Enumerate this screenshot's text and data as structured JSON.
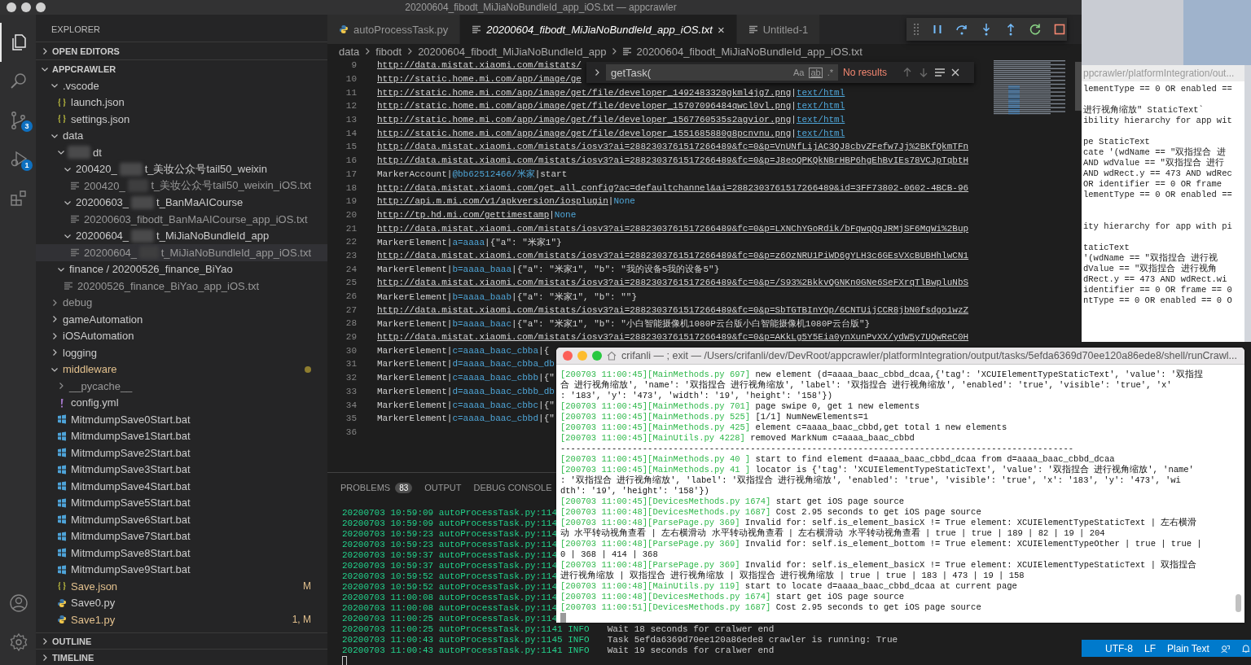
{
  "window": {
    "title": "20200604_fibodt_MiJiaNoBundleId_app_iOS.txt — appcrawler"
  },
  "activity_bar": {
    "items": [
      {
        "kind": "files",
        "selected": true
      },
      {
        "kind": "search",
        "selected": false
      },
      {
        "kind": "source-control",
        "selected": false,
        "badge": "3"
      },
      {
        "kind": "debug",
        "selected": false,
        "badge": "1"
      },
      {
        "kind": "extensions",
        "selected": false
      }
    ],
    "bottom": [
      {
        "kind": "account"
      },
      {
        "kind": "settings"
      }
    ]
  },
  "sidebar": {
    "title": "EXPLORER",
    "sections": [
      {
        "label": "OPEN EDITORS",
        "expanded": false
      },
      {
        "label": "APPCRAWLER",
        "expanded": true
      }
    ],
    "tree": [
      {
        "name": ".vscode",
        "kind": "folder",
        "expanded": true,
        "modified": false,
        "dimmed": false,
        "selected": false,
        "children": [
          {
            "name": "launch.json",
            "kind": "json",
            "modified": false,
            "dimmed": false,
            "selected": false
          },
          {
            "name": "settings.json",
            "kind": "json",
            "modified": false,
            "dimmed": false,
            "selected": false
          }
        ]
      },
      {
        "name": "data",
        "kind": "folder",
        "expanded": true,
        "modified": false,
        "dimmed": false,
        "selected": false,
        "children": [
          {
            "redacted": true,
            "tail": "dt",
            "kind": "folder",
            "expanded": true,
            "modified": false,
            "dimmed": false,
            "selected": false,
            "children": [
              {
                "name": "200420_",
                "redacted": true,
                "tail": "t_美妆公众号tail50_weixin",
                "kind": "folder",
                "expanded": true,
                "modified": false,
                "dimmed": false,
                "selected": false,
                "children": [
                  {
                    "name": "200420_",
                    "redacted": true,
                    "tail": "t_美妆公众号tail50_weixin_iOS.txt",
                    "kind": "txt",
                    "modified": false,
                    "dimmed": true,
                    "selected": false
                  }
                ]
              },
              {
                "name": "20200603_",
                "redacted": true,
                "tail": "t_BanMaAICourse",
                "kind": "folder",
                "expanded": true,
                "modified": false,
                "dimmed": false,
                "selected": false,
                "children": [
                  {
                    "name": "20200603_fibodt_BanMaAICourse_app_iOS.txt",
                    "kind": "txt",
                    "modified": false,
                    "dimmed": true,
                    "selected": false
                  }
                ]
              },
              {
                "name": "20200604_",
                "redacted": true,
                "tail": "t_MiJiaNoBundleId_app",
                "kind": "folder",
                "expanded": true,
                "modified": false,
                "dimmed": false,
                "selected": false,
                "children": [
                  {
                    "name": "20200604_",
                    "redacted": true,
                    "tail": "t_MiJiaNoBundleId_app_iOS.txt",
                    "kind": "txt",
                    "modified": false,
                    "dimmed": true,
                    "selected": true
                  }
                ]
              }
            ]
          },
          {
            "name": "finance / 20200526_finance_BiYao",
            "kind": "folder",
            "expanded": true,
            "modified": false,
            "dimmed": false,
            "selected": false,
            "children": [
              {
                "name": "20200526_finance_BiYao_app_iOS.txt",
                "kind": "txt",
                "modified": false,
                "dimmed": true,
                "selected": false
              }
            ]
          }
        ]
      },
      {
        "name": "debug",
        "kind": "folder",
        "expanded": false,
        "modified": false,
        "dimmed": true,
        "selected": false
      },
      {
        "name": "gameAutomation",
        "kind": "folder",
        "expanded": false,
        "modified": false,
        "dimmed": false,
        "selected": false
      },
      {
        "name": "iOSAutomation",
        "kind": "folder",
        "expanded": false,
        "modified": false,
        "dimmed": false,
        "selected": false
      },
      {
        "name": "logging",
        "kind": "folder",
        "expanded": false,
        "modified": false,
        "dimmed": false,
        "selected": false
      },
      {
        "name": "middleware",
        "kind": "folder",
        "expanded": true,
        "modified": true,
        "dimmed": false,
        "selected": false,
        "dot": true,
        "children": [
          {
            "name": "__pycache__",
            "kind": "folder",
            "expanded": false,
            "modified": false,
            "dimmed": true,
            "selected": false
          },
          {
            "name": "config.yml",
            "kind": "yml",
            "modified": false,
            "dimmed": false,
            "selected": false
          },
          {
            "name": "MitmdumpSave0Start.bat",
            "kind": "bat",
            "modified": false,
            "dimmed": false,
            "selected": false
          },
          {
            "name": "MitmdumpSave1Start.bat",
            "kind": "bat",
            "modified": false,
            "dimmed": false,
            "selected": false
          },
          {
            "name": "MitmdumpSave2Start.bat",
            "kind": "bat",
            "modified": false,
            "dimmed": false,
            "selected": false
          },
          {
            "name": "MitmdumpSave3Start.bat",
            "kind": "bat",
            "modified": false,
            "dimmed": false,
            "selected": false
          },
          {
            "name": "MitmdumpSave4Start.bat",
            "kind": "bat",
            "modified": false,
            "dimmed": false,
            "selected": false
          },
          {
            "name": "MitmdumpSave5Start.bat",
            "kind": "bat",
            "modified": false,
            "dimmed": false,
            "selected": false
          },
          {
            "name": "MitmdumpSave6Start.bat",
            "kind": "bat",
            "modified": false,
            "dimmed": false,
            "selected": false
          },
          {
            "name": "MitmdumpSave7Start.bat",
            "kind": "bat",
            "modified": false,
            "dimmed": false,
            "selected": false
          },
          {
            "name": "MitmdumpSave8Start.bat",
            "kind": "bat",
            "modified": false,
            "dimmed": false,
            "selected": false
          },
          {
            "name": "MitmdumpSave9Start.bat",
            "kind": "bat",
            "modified": false,
            "dimmed": false,
            "selected": false
          },
          {
            "name": "Save.json",
            "kind": "json",
            "modified": true,
            "dimmed": false,
            "selected": false,
            "badge": "M"
          },
          {
            "name": "Save0.py",
            "kind": "py",
            "modified": false,
            "dimmed": false,
            "selected": false
          },
          {
            "name": "Save1.py",
            "kind": "py",
            "modified": true,
            "dimmed": false,
            "selected": false,
            "badge": "1, M"
          }
        ]
      }
    ],
    "bottom_sections": [
      {
        "label": "OUTLINE",
        "expanded": false
      },
      {
        "label": "TIMELINE",
        "expanded": false
      }
    ]
  },
  "editor": {
    "tabs": [
      {
        "label": "autoProcessTask.py",
        "kind": "py",
        "selected": false,
        "preview": false
      },
      {
        "label": "20200604_fibodt_MiJiaNoBundleId_app_iOS.txt",
        "kind": "txt",
        "selected": true,
        "preview": true,
        "close": "×"
      },
      {
        "label": "Untitled-1",
        "kind": "txt",
        "selected": false,
        "preview": false
      }
    ],
    "breadcrumbs": [
      {
        "label": "data",
        "kind": "folder"
      },
      {
        "label": "fibodt",
        "kind": "folder"
      },
      {
        "label": "20200604_fibodt_MiJiaNoBundleId_app",
        "kind": "folder"
      },
      {
        "label": "20200604_fibodt_MiJiaNoBundleId_app_iOS.txt",
        "kind": "file"
      }
    ],
    "find": {
      "query": "getTask(",
      "options": [
        {
          "label": "Aa",
          "on": false
        },
        {
          "label": "ab",
          "on": false
        },
        {
          "label": ".*",
          "on": false
        }
      ],
      "result": "No results"
    },
    "lines": [
      {
        "number": "9",
        "segments": [
          {
            "kind": "link",
            "text": "http://data.mistat.xiaomi.com/mistats/"
          }
        ]
      },
      {
        "number": "10",
        "segments": [
          {
            "kind": "link",
            "text": "http://static.home.mi.com/app/image/ge"
          }
        ]
      },
      {
        "number": "11",
        "segments": [
          {
            "kind": "link",
            "text": "http://static.home.mi.com/app/image/get/file/developer_1492483320gkml4jg7.png"
          },
          {
            "kind": "plain",
            "text": "|"
          },
          {
            "kind": "link-value",
            "text": "text/html"
          }
        ]
      },
      {
        "number": "12",
        "segments": [
          {
            "kind": "link",
            "text": "http://static.home.mi.com/app/image/get/file/developer_15707096484qwcl0vl.png"
          },
          {
            "kind": "plain",
            "text": "|"
          },
          {
            "kind": "link-value",
            "text": "text/html"
          }
        ]
      },
      {
        "number": "13",
        "segments": [
          {
            "kind": "link",
            "text": "http://static.home.mi.com/app/image/get/file/developer_1567760535s2agvior.png"
          },
          {
            "kind": "plain",
            "text": "|"
          },
          {
            "kind": "link-value",
            "text": "text/html"
          }
        ]
      },
      {
        "number": "14",
        "segments": [
          {
            "kind": "link",
            "text": "http://static.home.mi.com/app/image/get/file/developer_1551685880g8pcnvnu.png"
          },
          {
            "kind": "plain",
            "text": "|"
          },
          {
            "kind": "link-value",
            "text": "text/html"
          }
        ]
      },
      {
        "number": "15",
        "segments": [
          {
            "kind": "link",
            "text": "http://data.mistat.xiaomi.com/mistats/iosv3?ai=2882303761517266489&fc=0&p=VnUNfLijAC3QJ8cbvZFefw7Jj%2BKfQkmTFn"
          }
        ]
      },
      {
        "number": "16",
        "segments": [
          {
            "kind": "link",
            "text": "http://data.mistat.xiaomi.com/mistats/iosv3?ai=2882303761517266489&fc=0&p=J8eoQPKQkNBrHBP6hgEhBvIEs78VCJpTqbtH"
          }
        ]
      },
      {
        "number": "17",
        "segments": [
          {
            "kind": "plain",
            "text": "MarkerAccount|"
          },
          {
            "kind": "value",
            "text": "@bb62512466/米家"
          },
          {
            "kind": "plain",
            "text": "|start"
          }
        ]
      },
      {
        "number": "18",
        "segments": [
          {
            "kind": "link",
            "text": "http://data.mistat.xiaomi.com/get_all_config?ac=defaultchannel&ai=2882303761517266489&id=3FF73802-0602-4BCB-96"
          }
        ]
      },
      {
        "number": "19",
        "segments": [
          {
            "kind": "link",
            "text": "http://api.m.mi.com/v1/apkversion/iosplugin"
          },
          {
            "kind": "plain",
            "text": "|"
          },
          {
            "kind": "value",
            "text": "None"
          }
        ]
      },
      {
        "number": "20",
        "segments": [
          {
            "kind": "link",
            "text": "http://tp.hd.mi.com/gettimestamp"
          },
          {
            "kind": "plain",
            "text": "|"
          },
          {
            "kind": "value",
            "text": "None"
          }
        ]
      },
      {
        "number": "21",
        "segments": [
          {
            "kind": "link",
            "text": "http://data.mistat.xiaomi.com/mistats/iosv3?ai=2882303761517266489&fc=0&p=LXNChYGoRdik/bFqwqQqJRMjSF6MqWi%2Bup"
          }
        ]
      },
      {
        "number": "22",
        "segments": [
          {
            "kind": "plain",
            "text": "MarkerElement|"
          },
          {
            "kind": "value",
            "text": "a=aaaa"
          },
          {
            "kind": "plain",
            "text": "|{\"a\": \"米家1\"}"
          }
        ]
      },
      {
        "number": "23",
        "segments": [
          {
            "kind": "link",
            "text": "http://data.mistat.xiaomi.com/mistats/iosv3?ai=2882303761517266489&fc=0&p=z6OzNRU1PiWD6gYLH3c6GEsVXcBUBHhlwCN1"
          }
        ]
      },
      {
        "number": "24",
        "segments": [
          {
            "kind": "plain",
            "text": "MarkerElement|"
          },
          {
            "kind": "value",
            "text": "b=aaaa_baaa"
          },
          {
            "kind": "plain",
            "text": "|{\"a\": \"米家1\", \"b\": \"我的设备5我的设备5\"}"
          }
        ]
      },
      {
        "number": "25",
        "segments": [
          {
            "kind": "link",
            "text": "http://data.mistat.xiaomi.com/mistats/iosv3?ai=2882303761517266489&fc=0&p=/S93%2BkkvQGNKn0GNe6SeFXrqTlBwpluNbS"
          }
        ]
      },
      {
        "number": "26",
        "segments": [
          {
            "kind": "plain",
            "text": "MarkerElement|"
          },
          {
            "kind": "value",
            "text": "b=aaaa_baab"
          },
          {
            "kind": "plain",
            "text": "|{\"a\": \"米家1\", \"b\": \"\"}"
          }
        ]
      },
      {
        "number": "27",
        "segments": [
          {
            "kind": "link",
            "text": "http://data.mistat.xiaomi.com/mistats/iosv3?ai=2882303761517266489&fc=0&p=SbTGTBInYOp/6CNTUijCCR8jbN0fsdgo1wzZ"
          }
        ]
      },
      {
        "number": "28",
        "segments": [
          {
            "kind": "plain",
            "text": "MarkerElement|"
          },
          {
            "kind": "value",
            "text": "b=aaaa_baac"
          },
          {
            "kind": "plain",
            "text": "|{\"a\": \"米家1\", \"b\": \"小白智能摄像机1080P云台版小白智能摄像机1080P云台版\"}"
          }
        ]
      },
      {
        "number": "29",
        "segments": [
          {
            "kind": "link",
            "text": "http://data.mistat.xiaomi.com/mistats/iosv3?ai=2882303761517266489&fc=0&p=AKkLg5Y5Eia0ynXunPvXX/ydW5y7UQwReC0H"
          }
        ]
      },
      {
        "number": "30",
        "segments": [
          {
            "kind": "plain",
            "text": "MarkerElement|"
          },
          {
            "kind": "value",
            "text": "c=aaaa_baac_cbba"
          },
          {
            "kind": "plain",
            "text": "|{"
          }
        ]
      },
      {
        "number": "31",
        "segments": [
          {
            "kind": "plain",
            "text": "MarkerElement|"
          },
          {
            "kind": "value",
            "text": "d=aaaa_baac_cbba_db"
          }
        ]
      },
      {
        "number": "32",
        "segments": [
          {
            "kind": "plain",
            "text": "MarkerElement|"
          },
          {
            "kind": "value",
            "text": "c=aaaa_baac_cbbb"
          },
          {
            "kind": "plain",
            "text": "|{\""
          }
        ]
      },
      {
        "number": "33",
        "segments": [
          {
            "kind": "plain",
            "text": "MarkerElement|"
          },
          {
            "kind": "value",
            "text": "d=aaaa_baac_cbbb_db"
          }
        ]
      },
      {
        "number": "34",
        "segments": [
          {
            "kind": "plain",
            "text": "MarkerElement|"
          },
          {
            "kind": "value",
            "text": "c=aaaa_baac_cbbc"
          },
          {
            "kind": "plain",
            "text": "|{\""
          }
        ]
      },
      {
        "number": "35",
        "segments": [
          {
            "kind": "plain",
            "text": "MarkerElement|"
          },
          {
            "kind": "value",
            "text": "c=aaaa_baac_cbbd"
          },
          {
            "kind": "plain",
            "text": "|{\""
          }
        ]
      },
      {
        "number": "36"
      }
    ]
  },
  "panel": {
    "tabs": [
      {
        "label": "PROBLEMS",
        "badge": "83",
        "selected": false
      },
      {
        "label": "OUTPUT",
        "selected": false
      },
      {
        "label": "DEBUG CONSOLE",
        "selected": false
      }
    ],
    "lines": [
      {
        "head": "20200703 10:59:09 autoProcessTask.py:114"
      },
      {
        "head": "20200703 10:59:09 autoProcessTask.py:114"
      },
      {
        "head": "20200703 10:59:23 autoProcessTask.py:114"
      },
      {
        "head": "20200703 10:59:23 autoProcessTask.py:114"
      },
      {
        "head": "20200703 10:59:37 autoProcessTask.py:114"
      },
      {
        "head": "20200703 10:59:37 autoProcessTask.py:114"
      },
      {
        "head": "20200703 10:59:52 autoProcessTask.py:114"
      },
      {
        "head": "20200703 10:59:52 autoProcessTask.py:114"
      },
      {
        "head": "20200703 11:00:08 autoProcessTask.py:114"
      },
      {
        "head": "20200703 11:00:08 autoProcessTask.py:114"
      },
      {
        "head": "20200703 11:00:25 autoProcessTask.py:114"
      },
      {
        "head": "20200703 11:00:25 autoProcessTask.py:1141 INFO",
        "message": "Wait 18 seconds for cralwer end"
      },
      {
        "head": "20200703 11:00:43 autoProcessTask.py:1145 INFO",
        "message": "Task 5efda6369d70ee120a86ede8 crawler is running: True"
      },
      {
        "head": "20200703 11:00:43 autoProcessTask.py:1141 INFO",
        "message": "Wait 19 seconds for cralwer end"
      }
    ]
  },
  "terminal": {
    "title": "crifanli — ; exit — /Users/crifanli/dev/DevRoot/appcrawler/platformIntegration/output/tasks/5efda6369d70ee120a86ede8/shell/runCrawl...",
    "lines": [
      {
        "prefix": "[200703 11:00:45][MainMethods.py 697]",
        "text": " new element (d=aaaa_baac_cbbd_dcaa,{'tag': 'XCUIElementTypeStaticText', 'value': '双指捏"
      },
      {
        "text": "合 进行视角缩放', 'name': '双指捏合 进行视角缩放', 'label': '双指捏合 进行视角缩放', 'enabled': 'true', 'visible': 'true', 'x'"
      },
      {
        "text": ": '183', 'y': '473', 'width': '19', 'height': '158'})"
      },
      {
        "prefix": "[200703 11:00:45][MainMethods.py 701]",
        "text": " page swipe 0, get 1 new elements"
      },
      {
        "prefix": "[200703 11:00:45][MainMethods.py 525]",
        "text": " [1/1] NumNewElements=1"
      },
      {
        "prefix": "[200703 11:00:45][MainMethods.py 425]",
        "text": " element c=aaaa_baac_cbbd,get total 1 new elements"
      },
      {
        "prefix": "[200703 11:00:45][MainUtils.py 4228]",
        "text": " removed MarkNum c=aaaa_baac_cbbd"
      },
      {
        "text": "----------------------------------------------------------------------------------------------------"
      },
      {
        "prefix": "[200703 11:00:45][MainMethods.py 40 ]",
        "text": " start to find element d=aaaa_baac_cbbd_dcaa from d=aaaa_baac_cbbd_dcaa"
      },
      {
        "prefix": "[200703 11:00:45][MainMethods.py 41 ]",
        "text": " locator is {'tag': 'XCUIElementTypeStaticText', 'value': '双指捏合 进行视角缩放', 'name'"
      },
      {
        "text": ": '双指捏合 进行视角缩放', 'label': '双指捏合 进行视角缩放', 'enabled': 'true', 'visible': 'true', 'x': '183', 'y': '473', 'wi"
      },
      {
        "text": "dth': '19', 'height': '158'})"
      },
      {
        "prefix": "[200703 11:00:45][DevicesMethods.py 1674]",
        "text": " start get iOS page source"
      },
      {
        "prefix": "[200703 11:00:48][DevicesMethods.py 1687]",
        "text": " Cost 2.95 seconds to get iOS page source"
      },
      {
        "prefix": "[200703 11:00:48][ParsePage.py 369]",
        "text": " Invalid for: self.is_element_basicX != True element: XCUIElementTypeStaticText | 左右横滑"
      },
      {
        "text": "动 水平转动视角查看 | 左右横滑动 水平转动视角查看 | 左右横滑动 水平转动视角查看 | true | true | 189 | 82 | 19 | 204"
      },
      {
        "prefix": "[200703 11:00:48][ParsePage.py 369]",
        "text": " Invalid for: self.is_element_bottom != True element: XCUIElementTypeOther | true | true |"
      },
      {
        "text": "0 | 368 | 414 | 368"
      },
      {
        "prefix": "[200703 11:00:48][ParsePage.py 369]",
        "text": " Invalid for: self.is_element_basicX != True element: XCUIElementTypeStaticText | 双指捏合"
      },
      {
        "text": "进行视角缩放 | 双指捏合 进行视角缩放 | 双指捏合 进行视角缩放 | true | true | 183 | 473 | 19 | 158"
      },
      {
        "prefix": "[200703 11:00:48][MainUtils.py 119]",
        "text": " start to locate d=aaaa_baac_cbbd_dcaa at current page"
      },
      {
        "prefix": "[200703 11:00:48][DevicesMethods.py 1674]",
        "text": " start get iOS page source"
      },
      {
        "prefix": "[200703 11:00:51][DevicesMethods.py 1687]",
        "text": " Cost 2.95 seconds to get iOS page source"
      }
    ]
  },
  "back_terminal": {
    "title": "ppcrawler/platformIntegration/out...",
    "lines": [
      {
        "kind": "text",
        "text": "lementType == 0 OR enabled =="
      },
      {
        "kind": "blank"
      },
      {
        "kind": "text",
        "text": "进行视角缩放\" StaticText`"
      },
      {
        "kind": "text",
        "text": "ibility hierarchy for app wit"
      },
      {
        "kind": "blank"
      },
      {
        "kind": "text",
        "text": "pe StaticText"
      },
      {
        "kind": "text",
        "text": "cate '(wdName == \"双指捏合 进"
      },
      {
        "kind": "text",
        "text": "AND wdValue == \"双指捏合 进行"
      },
      {
        "kind": "text",
        "text": "AND wdRect.y == 473 AND wdRec"
      },
      {
        "kind": "text",
        "text": "OR identifier == 0 OR frame"
      },
      {
        "kind": "text",
        "text": "lementType == 0 OR enabled =="
      },
      {
        "kind": "blank"
      },
      {
        "kind": "blank"
      },
      {
        "kind": "text",
        "text": "ity hierarchy for app with pi"
      },
      {
        "kind": "blank"
      },
      {
        "kind": "text",
        "text": "taticText"
      },
      {
        "kind": "text",
        "text": "'(wdName == \"双指捏合 进行视"
      },
      {
        "kind": "text",
        "text": "dValue == \"双指捏合 进行视角"
      },
      {
        "kind": "text",
        "text": "dRect.y == 473 AND wdRect.wi"
      },
      {
        "kind": "text",
        "text": "identifier == 0 OR frame == 0"
      },
      {
        "kind": "text",
        "text": "ntType == 0 OR enabled == 0 O"
      }
    ]
  },
  "status_bar": {
    "items": [
      "UTF-8",
      "LF",
      "Plain Text"
    ]
  }
}
